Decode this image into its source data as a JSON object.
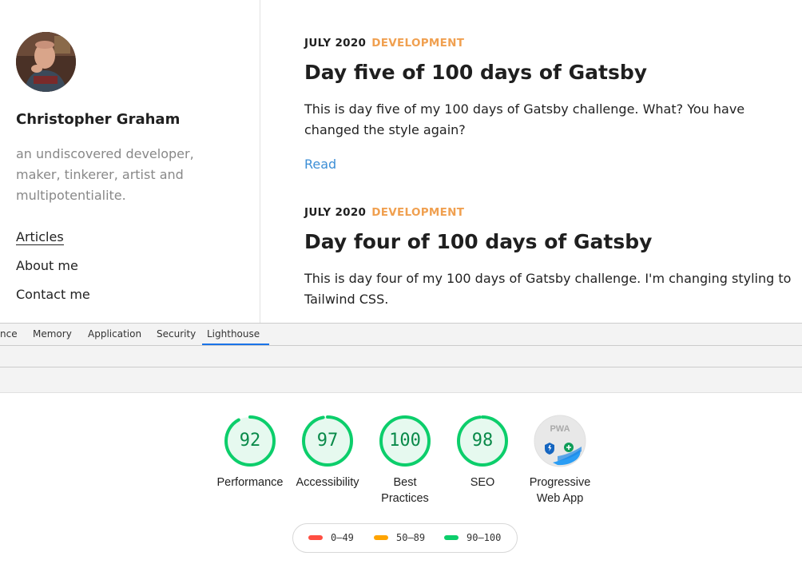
{
  "blog": {
    "author": {
      "name": "Christopher Graham",
      "bio": "an undiscovered developer, maker, tinkerer, artist and multipotentialite."
    },
    "nav": [
      {
        "label": "Articles",
        "active": true
      },
      {
        "label": "About me",
        "active": false
      },
      {
        "label": "Contact me",
        "active": false
      }
    ],
    "posts": [
      {
        "date": "JULY 2020",
        "category": "DEVELOPMENT",
        "title": "Day five of 100 days of Gatsby",
        "excerpt": "This is day five of my 100 days of Gatsby challenge. What? You have changed the style again?",
        "read_label": "Read"
      },
      {
        "date": "JULY 2020",
        "category": "DEVELOPMENT",
        "title": "Day four of 100 days of Gatsby",
        "excerpt": "This is day four of my 100 days of Gatsby challenge. I'm changing styling to Tailwind CSS."
      }
    ]
  },
  "devtools": {
    "tabs": [
      {
        "label": "nce",
        "active": false
      },
      {
        "label": "Memory",
        "active": false
      },
      {
        "label": "Application",
        "active": false
      },
      {
        "label": "Security",
        "active": false
      },
      {
        "label": "Lighthouse",
        "active": true
      }
    ],
    "lighthouse": {
      "scores": [
        {
          "label_line1": "Performance",
          "label_line2": "",
          "value": 92
        },
        {
          "label_line1": "Accessibility",
          "label_line2": "",
          "value": 97
        },
        {
          "label_line1": "Best",
          "label_line2": "Practices",
          "value": 100
        },
        {
          "label_line1": "SEO",
          "label_line2": "",
          "value": 98
        }
      ],
      "pwa": {
        "label_line1": "Progressive",
        "label_line2": "Web App",
        "badge_text": "PWA",
        "icon": "pwa-badge-icon"
      },
      "legend": [
        {
          "label": "0–49",
          "color": "#ff4e42"
        },
        {
          "label": "50–89",
          "color": "#ffa400"
        },
        {
          "label": "90–100",
          "color": "#0cce6b"
        }
      ],
      "pass_color": "#0cce6b"
    }
  }
}
